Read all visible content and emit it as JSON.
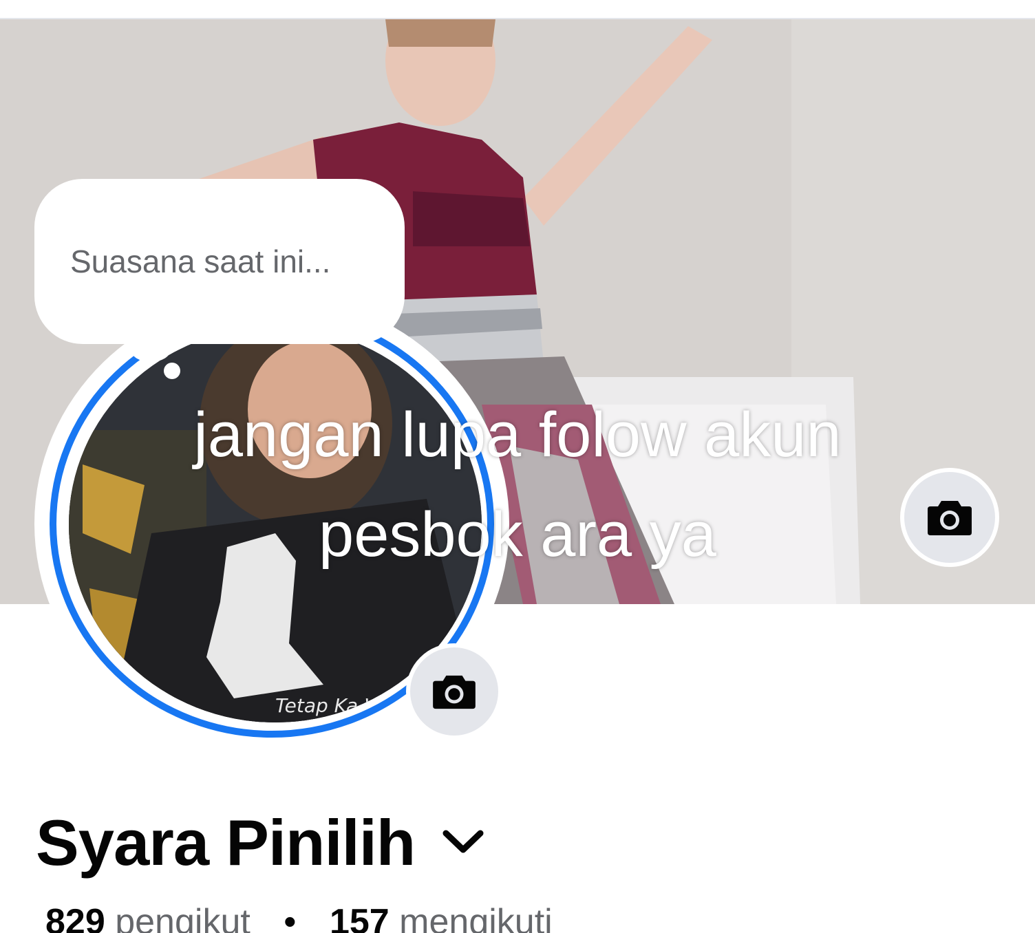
{
  "note": {
    "placeholder": "Suasana saat ini..."
  },
  "overlay": {
    "line1": "jangan lupa folow akun",
    "line2": "pesbok ara ya"
  },
  "profile": {
    "name": "Syara Pinilih",
    "followers_count": "829",
    "followers_label": "pengikut",
    "separator": "•",
    "following_count": "157",
    "following_label": "mengikuti"
  },
  "avatar_tshirt_text": "Tetap Ka Waktu",
  "icons": {
    "cover_camera": "camera-icon",
    "avatar_camera": "camera-icon",
    "name_menu": "chevron-down-icon"
  },
  "colors": {
    "story_ring": "#1877f2",
    "icon_button_bg": "#e4e6eb",
    "text_primary": "#050505",
    "text_secondary": "#65676b"
  }
}
